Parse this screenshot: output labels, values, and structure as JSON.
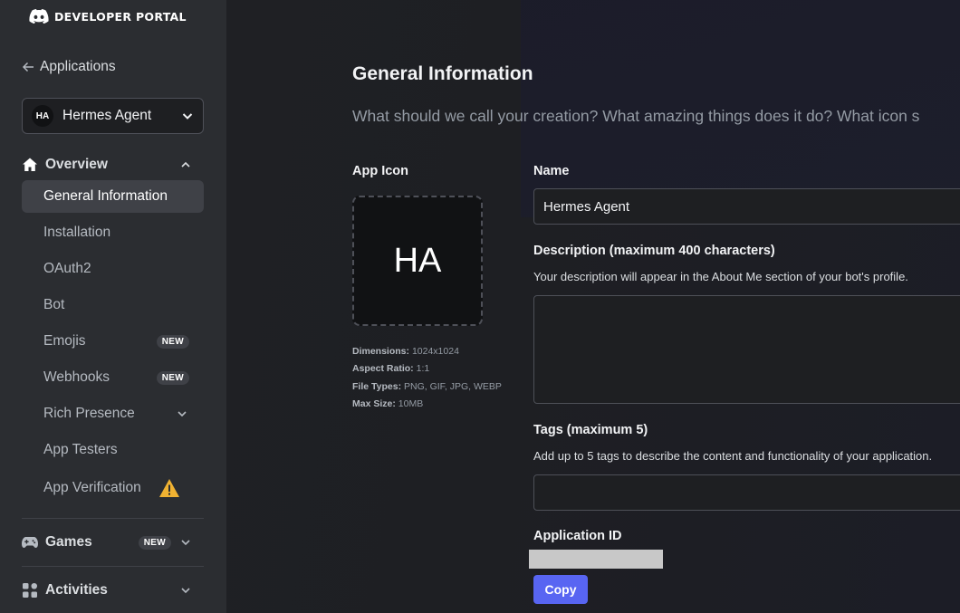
{
  "brand": {
    "name": "DEVELOPER PORTAL",
    "logo_icon": "discord-logo-icon"
  },
  "sidebar": {
    "back_label": "Applications",
    "app_selector": {
      "avatar_initials": "HA",
      "name": "Hermes Agent"
    },
    "overview": {
      "label": "Overview",
      "items": [
        {
          "label": "General Information",
          "active": true
        },
        {
          "label": "Installation"
        },
        {
          "label": "OAuth2"
        },
        {
          "label": "Bot"
        },
        {
          "label": "Emojis",
          "badge": "NEW"
        },
        {
          "label": "Webhooks",
          "badge": "NEW"
        },
        {
          "label": "Rich Presence",
          "expandable": true
        },
        {
          "label": "App Testers"
        },
        {
          "label": "App Verification",
          "warning": true
        }
      ]
    },
    "games": {
      "label": "Games",
      "badge": "NEW"
    },
    "activities": {
      "label": "Activities"
    }
  },
  "main": {
    "title": "General Information",
    "subtitle": "What should we call your creation? What amazing things does it do? What icon s",
    "app_icon": {
      "label": "App Icon",
      "initials": "HA",
      "dimensions_label": "Dimensions:",
      "dimensions": "1024x1024",
      "aspect_label": "Aspect Ratio:",
      "aspect": "1:1",
      "types_label": "File Types:",
      "types": "PNG, GIF, JPG, WEBP",
      "size_label": "Max Size:",
      "size": "10MB"
    },
    "name_field": {
      "label": "Name",
      "value": "Hermes Agent"
    },
    "description_field": {
      "label": "Description (maximum 400 characters)",
      "help": "Your description will appear in the About Me section of your bot's profile.",
      "value": ""
    },
    "tags_field": {
      "label": "Tags (maximum 5)",
      "help": "Add up to 5 tags to describe the content and functionality of your application.",
      "value": ""
    },
    "application_id": {
      "label": "Application ID",
      "copy_label": "Copy"
    }
  },
  "colors": {
    "accent": "#5865f2",
    "warning": "#f0b232",
    "sidebar_bg": "#2b2d31",
    "page_bg": "#1e1f22"
  }
}
